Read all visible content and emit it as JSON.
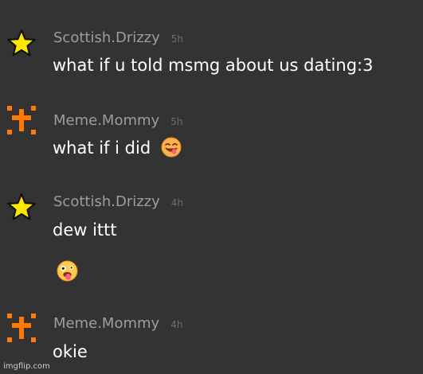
{
  "messages": [
    {
      "user": "Scottish.Drizzy",
      "time": "5h",
      "avatar_icon": "star-icon",
      "lines": [
        "what if u told msmg about us dating:3"
      ]
    },
    {
      "user": "Meme.Mommy",
      "time": "5h",
      "avatar_icon": "pixel-cross-icon",
      "lines": [
        "what if i did"
      ],
      "emoji": "smiling-face-with-tongue-emoji"
    },
    {
      "user": "Scottish.Drizzy",
      "time": "4h",
      "avatar_icon": "star-icon",
      "lines": [
        "dew ittt"
      ],
      "emoji_line": "zany-face-emoji"
    },
    {
      "user": "Meme.Mommy",
      "time": "4h",
      "avatar_icon": "pixel-cross-icon",
      "lines": [
        "okie"
      ]
    }
  ],
  "watermark": "imgflip.com",
  "colors": {
    "background": "#333333",
    "username": "#9d9d9d",
    "timestamp": "#6f6f6f",
    "message_text": "#ffffff",
    "star": "#ffe600",
    "pixel_avatar": "#ff7a00"
  }
}
